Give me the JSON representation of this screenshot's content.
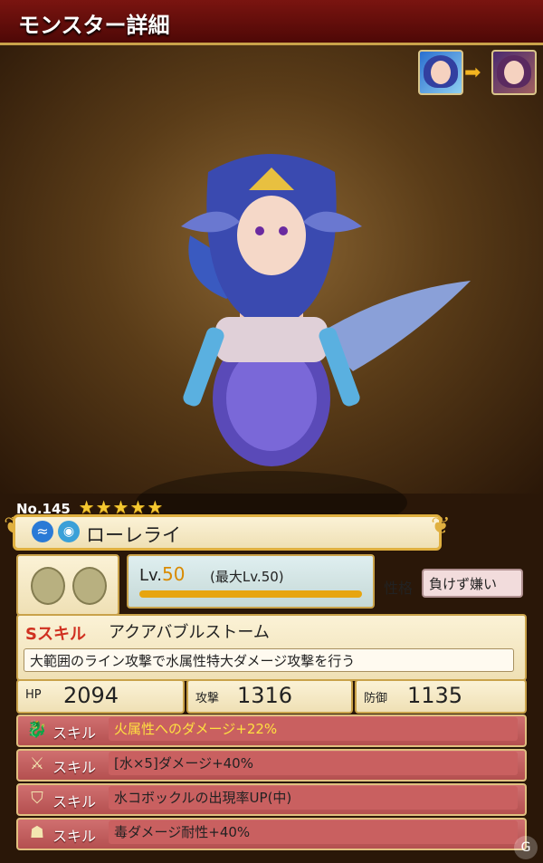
{
  "header": {
    "title": "モンスター詳細"
  },
  "monster": {
    "number_label": "No.145",
    "stars": "★★★★★",
    "name": "ローレライ",
    "element_icon": "water-wave-icon",
    "type_icon": "fish-type-icon"
  },
  "evolution": {
    "arrow": "➡"
  },
  "level": {
    "prefix": "Lv.",
    "value": "50",
    "max_text": "(最大Lv.50)",
    "progress": 1.0
  },
  "trait": {
    "label": "性格",
    "value": "負けず嫌い"
  },
  "s_skill": {
    "badge": "Sスキル",
    "title": "アクアバブルストーム",
    "description": "大範囲のライン攻撃で水属性特大ダメージ攻撃を行う"
  },
  "stats": {
    "hp_label": "HP",
    "hp_value": "2094",
    "atk_label": "攻撃",
    "atk_value": "1316",
    "def_label": "防御",
    "def_value": "1135"
  },
  "abilities": [
    {
      "label": "スキル",
      "text": "火属性へのダメージ+22%",
      "icon": "dragon-icon",
      "highlight": true
    },
    {
      "label": "スキル",
      "text": "[水×5]ダメージ+40%",
      "icon": "sword-icon",
      "highlight": false
    },
    {
      "label": "スキル",
      "text": "水コボックルの出現率UP(中)",
      "icon": "shield-icon",
      "highlight": false
    },
    {
      "label": "スキル",
      "text": "毒ダメージ耐性+40%",
      "icon": "helmet-icon",
      "highlight": false
    }
  ],
  "colors": {
    "header": "#7a1410",
    "gold": "#e0b040",
    "ability_bg": "#c96060",
    "level_num": "#d98a00"
  }
}
